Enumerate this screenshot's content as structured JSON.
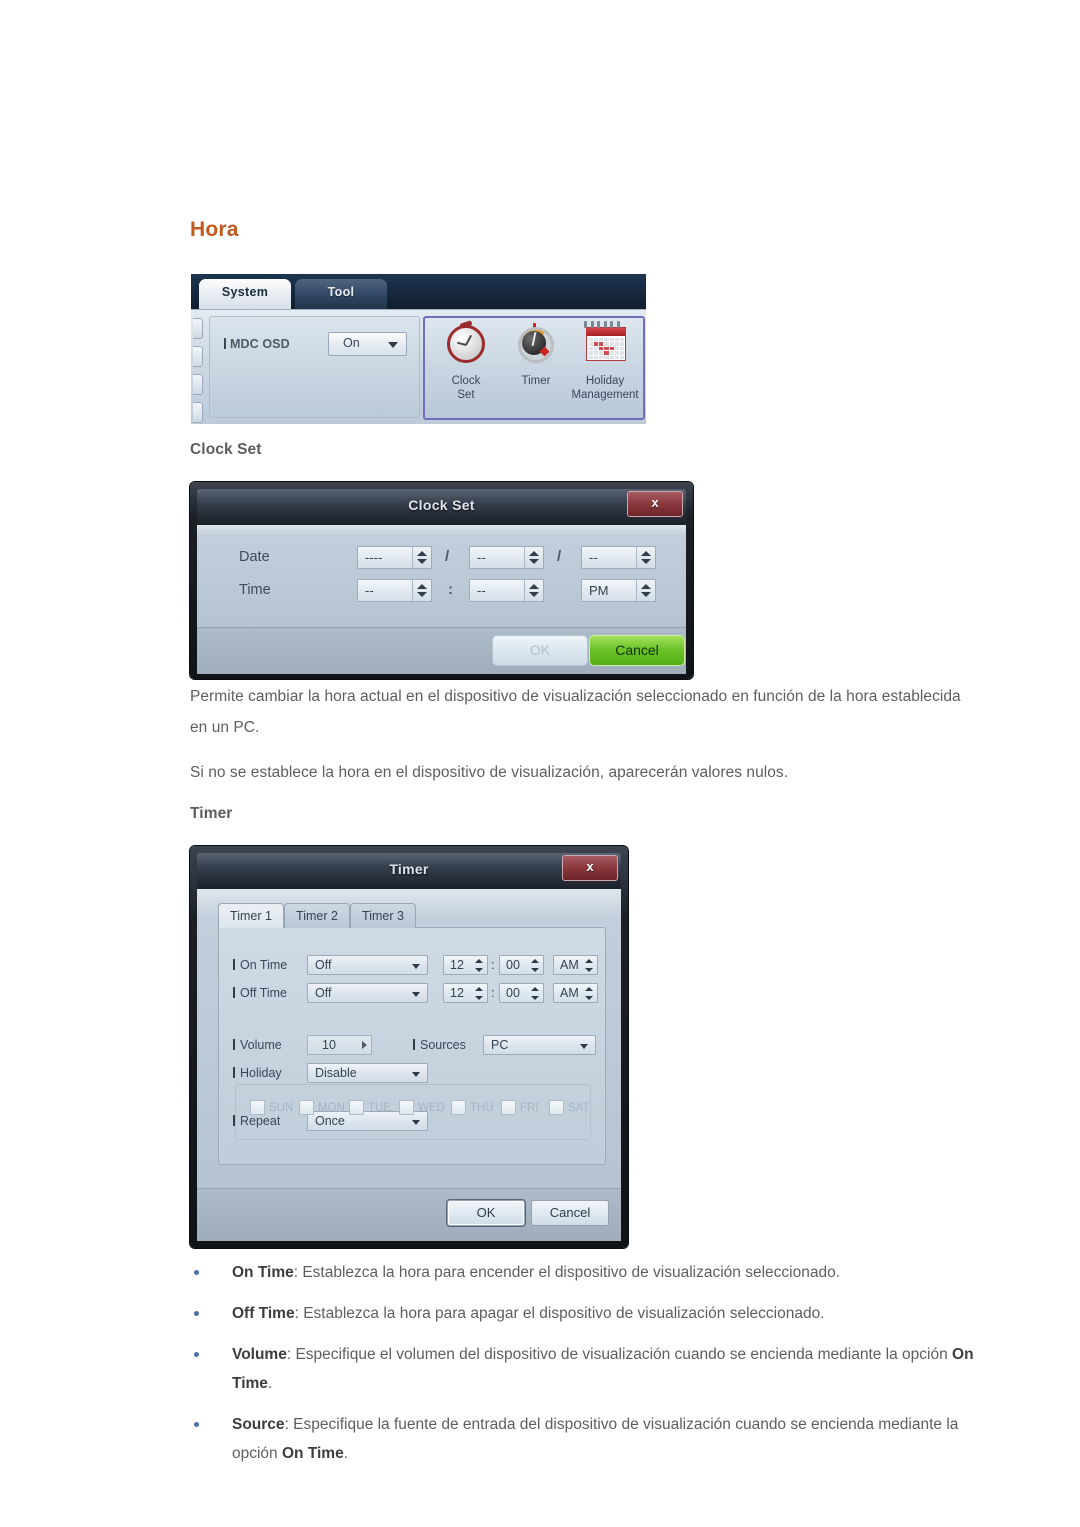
{
  "page": {
    "heading": "Hora"
  },
  "ribbon": {
    "tabs": [
      {
        "label": "System",
        "active": true
      },
      {
        "label": "Tool",
        "active": false
      }
    ],
    "osd": {
      "label": "MDC OSD",
      "value": "On"
    },
    "items": [
      {
        "icon": "clock-icon",
        "line1": "Clock",
        "line2": "Set"
      },
      {
        "icon": "timer-icon",
        "line1": "Timer",
        "line2": ""
      },
      {
        "icon": "calendar-icon",
        "line1": "Holiday",
        "line2": "Management"
      }
    ]
  },
  "clock_section": {
    "subheading": "Clock Set",
    "dialog": {
      "title": "Clock Set",
      "close_label": "x",
      "date_label": "Date",
      "time_label": "Time",
      "date_year": "----",
      "date_month": "--",
      "date_day": "--",
      "time_hour": "--",
      "time_minute": "--",
      "time_meridiem": "PM",
      "separator_date": "/",
      "separator_time": ":",
      "ok_label": "OK",
      "cancel_label": "Cancel"
    },
    "paragraph1": "Permite cambiar la hora actual en el dispositivo de visualización seleccionado en función de la hora establecida en un PC.",
    "paragraph2": "Si no se establece la hora en el dispositivo de visualización, aparecerán valores nulos."
  },
  "timer_section": {
    "subheading": "Timer",
    "dialog": {
      "title": "Timer",
      "close_label": "x",
      "tabs": [
        {
          "label": "Timer 1",
          "selected": true
        },
        {
          "label": "Timer 2",
          "selected": false
        },
        {
          "label": "Timer 3",
          "selected": false
        }
      ],
      "on_time": {
        "label": "On Time",
        "state": "Off",
        "hour": "12",
        "minute": "00",
        "meridiem": "AM"
      },
      "off_time": {
        "label": "Off Time",
        "state": "Off",
        "hour": "12",
        "minute": "00",
        "meridiem": "AM"
      },
      "volume": {
        "label": "Volume",
        "value": "10"
      },
      "sources": {
        "label": "Sources",
        "value": "PC"
      },
      "holiday": {
        "label": "Holiday",
        "value": "Disable"
      },
      "repeat": {
        "label": "Repeat",
        "value": "Once"
      },
      "days": [
        "SUN",
        "MON",
        "TUE",
        "WED",
        "THU",
        "FRI",
        "SAT"
      ],
      "colon": ":",
      "ok_label": "OK",
      "cancel_label": "Cancel"
    }
  },
  "bullets": [
    {
      "term": "On Time",
      "rest": ": Establezca la hora para encender el dispositivo de visualización seleccionado."
    },
    {
      "term": "Off Time",
      "rest": ": Establezca la hora para apagar el dispositivo de visualización seleccionado."
    },
    {
      "term": "Volume",
      "rest": ": Especifique el volumen del dispositivo de visualización cuando se encienda mediante la opción ",
      "term2": "On Time",
      "rest2": "."
    },
    {
      "term": "Source",
      "rest": ": Especifique la fuente de entrada del dispositivo de visualización cuando se encienda mediante la opción ",
      "term2": "On Time",
      "rest2": "."
    }
  ],
  "colors": {
    "heading_orange": "#c4591f",
    "body_gray": "#5d5e60",
    "bullet_blue": "#4a6fa5",
    "cancel_green": "#6cc42a",
    "close_red": "#8d3a40",
    "ribbon_highlight": "#6f6fbe"
  }
}
